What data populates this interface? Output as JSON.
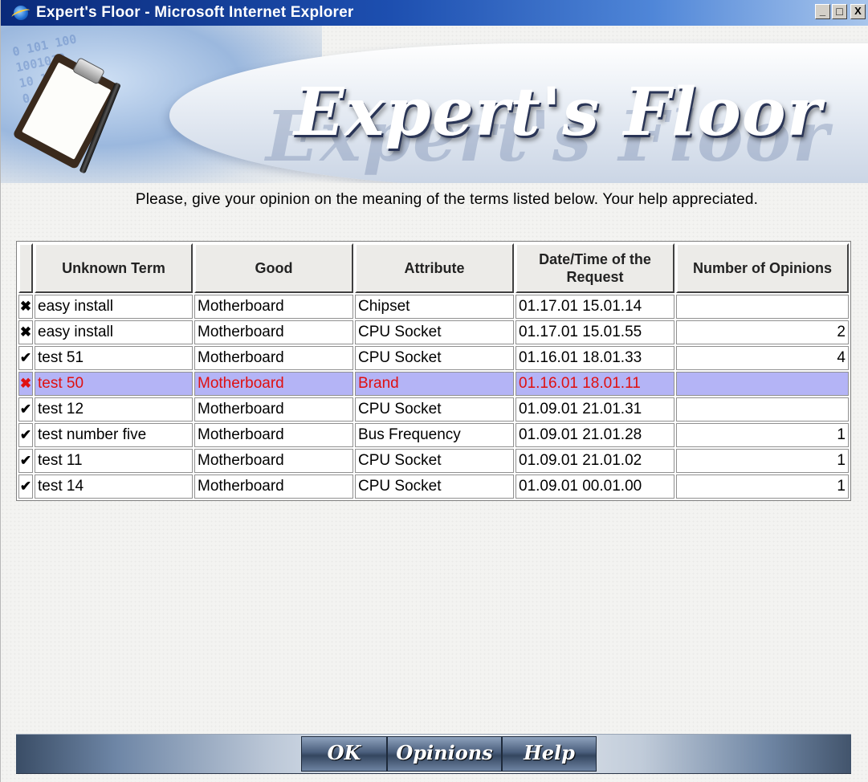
{
  "window": {
    "title": "Expert's Floor - Microsoft Internet Explorer",
    "controls": {
      "minimize": "_",
      "maximize": "□",
      "close": "X"
    }
  },
  "banner": {
    "title": "Expert's Floor",
    "digits": [
      "0 101 100",
      "1001010",
      "10 1100",
      "0 1 100"
    ]
  },
  "instructions": "Please, give your opinion on the meaning of the terms listed below. Your help appreciated.",
  "table": {
    "headers": [
      "Unknown Term",
      "Good",
      "Attribute",
      "Date/Time of the Request",
      "Number of Opinions"
    ],
    "rows": [
      {
        "status": "cross",
        "term": "easy install",
        "good": "Motherboard",
        "attribute": "Chipset",
        "datetime": "01.17.01 15.01.14",
        "opinions": ""
      },
      {
        "status": "cross",
        "term": "easy install",
        "good": "Motherboard",
        "attribute": "CPU Socket",
        "datetime": "01.17.01 15.01.55",
        "opinions": "2"
      },
      {
        "status": "check",
        "term": "test 51",
        "good": "Motherboard",
        "attribute": "CPU Socket",
        "datetime": "01.16.01 18.01.33",
        "opinions": "4"
      },
      {
        "status": "cross",
        "term": "test 50",
        "good": "Motherboard",
        "attribute": "Brand",
        "datetime": "01.16.01 18.01.11",
        "opinions": "",
        "selected": true
      },
      {
        "status": "check",
        "term": "test 12",
        "good": "Motherboard",
        "attribute": "CPU Socket",
        "datetime": "01.09.01 21.01.31",
        "opinions": ""
      },
      {
        "status": "check",
        "term": "test number five",
        "good": "Motherboard",
        "attribute": "Bus Frequency",
        "datetime": "01.09.01 21.01.28",
        "opinions": "1"
      },
      {
        "status": "check",
        "term": "test 11",
        "good": "Motherboard",
        "attribute": "CPU Socket",
        "datetime": "01.09.01 21.01.02",
        "opinions": "1"
      },
      {
        "status": "check",
        "term": "test 14",
        "good": "Motherboard",
        "attribute": "CPU Socket",
        "datetime": "01.09.01 00.01.00",
        "opinions": "1"
      }
    ]
  },
  "toolbar": {
    "ok_label": "OK",
    "opinions_label": "Opinions",
    "help_label": "Help"
  },
  "colors": {
    "selected_row_bg": "#b4b4f6",
    "selected_row_text": "#e01010",
    "check": "#2b8a2b",
    "cross": "#d21e1e"
  },
  "icons": {
    "check": "✔",
    "cross": "✖"
  }
}
